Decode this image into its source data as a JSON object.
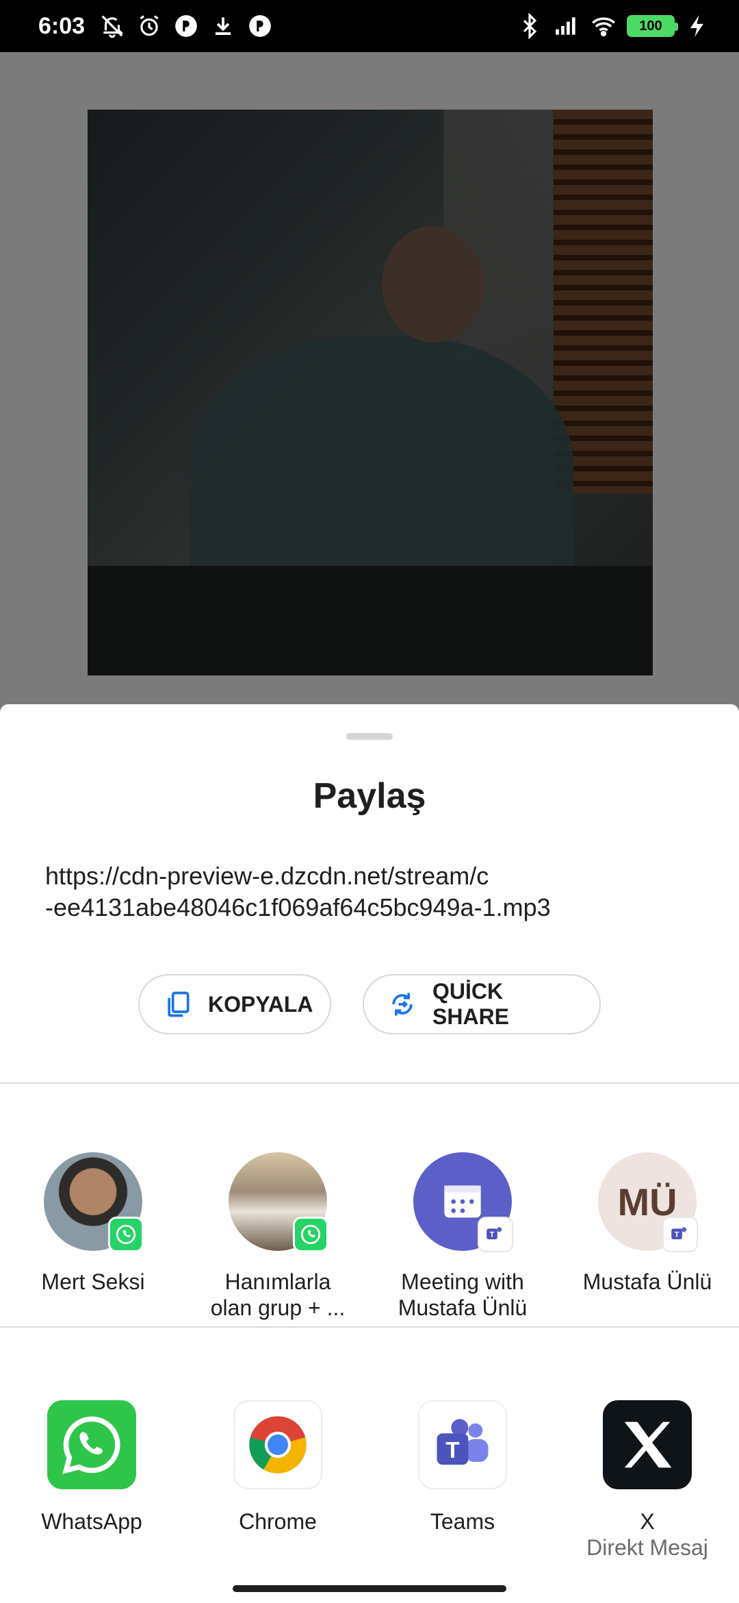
{
  "status_bar": {
    "time": "6:03",
    "battery": "100"
  },
  "sheet": {
    "title": "Paylaş",
    "share_text_line1": "https://cdn-preview-e.dzcdn.net/stream/c",
    "share_text_line2": "-ee4131abe48046c1f069af64c5bc949a-1.mp3",
    "copy_label": "KOPYALA",
    "quick_share_label": "QUİCK SHARE"
  },
  "contacts": [
    {
      "line1": "Mert Seksi",
      "line2": "",
      "badge": "whatsapp"
    },
    {
      "line1": "Hanımlarla",
      "line2": "olan grup + ...",
      "badge": "whatsapp"
    },
    {
      "line1": "Meeting with",
      "line2": "Mustafa Ünlü",
      "badge": "teams"
    },
    {
      "line1": "Mustafa Ünlü",
      "line2": "",
      "badge": "teams",
      "initials": "MÜ"
    }
  ],
  "apps": [
    {
      "label": "WhatsApp",
      "sub": ""
    },
    {
      "label": "Chrome",
      "sub": ""
    },
    {
      "label": "Teams",
      "sub": ""
    },
    {
      "label": "X",
      "sub": "Direkt Mesaj"
    }
  ],
  "colors": {
    "whatsapp": "#2fc54a",
    "teams": "#5b5fc7",
    "accent_blue": "#1a73e8"
  }
}
